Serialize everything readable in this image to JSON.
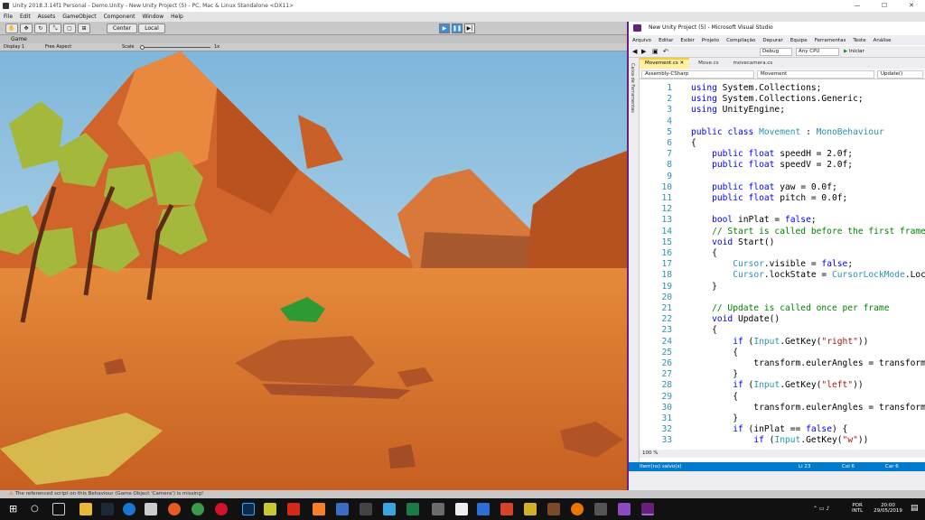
{
  "unity": {
    "title": "Unity 2018.3.14f1 Personal - Demo.Unity - New Unity Project (5) - PC, Mac & Linux Standalone <DX11>",
    "window_controls": [
      "—",
      "☐",
      "✕"
    ],
    "menu": [
      "File",
      "Edit",
      "Assets",
      "GameObject",
      "Component",
      "Window",
      "Help"
    ],
    "toolbar": {
      "center": "Center",
      "local": "Local"
    },
    "game_tab": "Game",
    "display": "Display 1",
    "aspect": "Free Aspect",
    "scale_label": "Scale",
    "scale_value": "1x",
    "status_message": "The referenced script on this Behaviour (Game Object 'Camera') is missing!"
  },
  "vs": {
    "title": "New Unity Project (5) - Microsoft Visual Studio",
    "menu": [
      "Arquivo",
      "Editar",
      "Exibir",
      "Projeto",
      "Compilação",
      "Depurar",
      "Equipe",
      "Ferramentas",
      "Teste",
      "Análise"
    ],
    "config": "Debug",
    "platform": "Any CPU",
    "start": "Iniciar",
    "side_panel": "Caixa de Ferramentas",
    "tabs": [
      "Movement.cs",
      "Move.cs",
      "movecamera.cs"
    ],
    "nav": {
      "project": "Assembly-CSharp",
      "class": "Movement",
      "method": "Update()"
    },
    "zoom": "100 %",
    "status": {
      "saved": "Item(ns) salvo(s)",
      "line": "Li 23",
      "col": "Col 6",
      "char": "Car 6"
    },
    "code": [
      {
        "n": "1",
        "t": "using System.Collections;"
      },
      {
        "n": "2",
        "t": "using System.Collections.Generic;"
      },
      {
        "n": "3",
        "t": "using UnityEngine;"
      },
      {
        "n": "4",
        "t": ""
      },
      {
        "n": "5",
        "t": "public class Movement : MonoBehaviour"
      },
      {
        "n": "6",
        "t": "{"
      },
      {
        "n": "7",
        "t": "    public float speedH = 2.0f;"
      },
      {
        "n": "8",
        "t": "    public float speedV = 2.0f;"
      },
      {
        "n": "9",
        "t": ""
      },
      {
        "n": "10",
        "t": "    public float yaw = 0.0f;"
      },
      {
        "n": "11",
        "t": "    public float pitch = 0.0f;"
      },
      {
        "n": "12",
        "t": ""
      },
      {
        "n": "13",
        "t": "    bool inPlat = false;"
      },
      {
        "n": "14",
        "t": "    // Start is called before the first frame up"
      },
      {
        "n": "15",
        "t": "    void Start()"
      },
      {
        "n": "16",
        "t": "    {"
      },
      {
        "n": "17",
        "t": "        Cursor.visible = false;"
      },
      {
        "n": "18",
        "t": "        Cursor.lockState = CursorLockMode.Locked"
      },
      {
        "n": "19",
        "t": "    }"
      },
      {
        "n": "20",
        "t": ""
      },
      {
        "n": "21",
        "t": "    // Update is called once per frame"
      },
      {
        "n": "22",
        "t": "    void Update()"
      },
      {
        "n": "23",
        "t": "    {"
      },
      {
        "n": "24",
        "t": "        if (Input.GetKey(\"right\"))"
      },
      {
        "n": "25",
        "t": "        {"
      },
      {
        "n": "26",
        "t": "            transform.eulerAngles = transform.eu"
      },
      {
        "n": "27",
        "t": "        }"
      },
      {
        "n": "28",
        "t": "        if (Input.GetKey(\"left\"))"
      },
      {
        "n": "29",
        "t": "        {"
      },
      {
        "n": "30",
        "t": "            transform.eulerAngles = transform.eu"
      },
      {
        "n": "31",
        "t": "        }"
      },
      {
        "n": "32",
        "t": "        if (inPlat == false) {"
      },
      {
        "n": "33",
        "t": "            if (Input.GetKey(\"w\"))"
      }
    ]
  },
  "taskbar": {
    "lang": "POR",
    "kbd": "INTL",
    "time": "20:00",
    "date": "29/05/2019"
  },
  "colors": {
    "vs_accent": "#68217a",
    "vs_status": "#007acc",
    "sky": "#a9cfe6",
    "sand": "#e07a2c"
  }
}
